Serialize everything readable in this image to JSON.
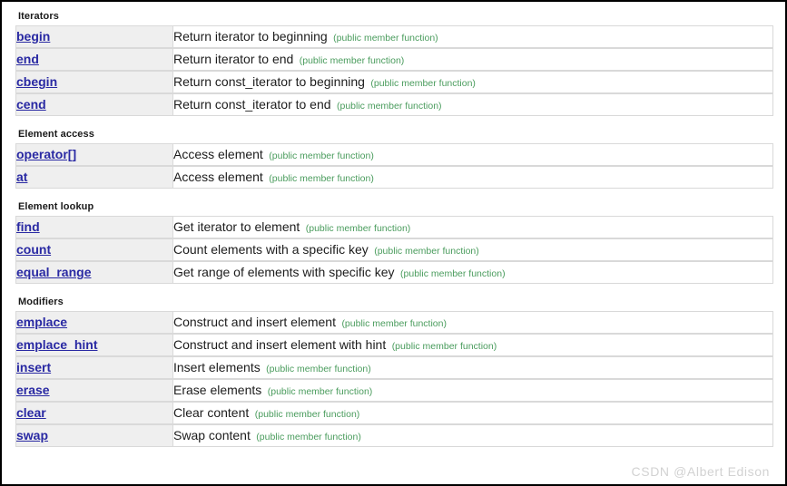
{
  "watermark": "CSDN @Albert Edison",
  "note_label": "(public member function)",
  "sections": [
    {
      "title": "Iterators",
      "rows": [
        {
          "name": "begin",
          "desc": "Return iterator to beginning",
          "note": "(public member function)"
        },
        {
          "name": "end",
          "desc": "Return iterator to end",
          "note": "(public member function)"
        },
        {
          "name": "cbegin",
          "desc": "Return const_iterator to beginning",
          "note": "(public member function)"
        },
        {
          "name": "cend",
          "desc": "Return const_iterator to end",
          "note": "(public member function)"
        }
      ]
    },
    {
      "title": "Element access",
      "rows": [
        {
          "name": "operator[]",
          "desc": "Access element",
          "note": "(public member function)"
        },
        {
          "name": "at",
          "desc": "Access element",
          "note": "(public member function)"
        }
      ]
    },
    {
      "title": "Element lookup",
      "rows": [
        {
          "name": "find",
          "desc": "Get iterator to element",
          "note": "(public member function)"
        },
        {
          "name": "count",
          "desc": "Count elements with a specific key",
          "note": "(public member function)"
        },
        {
          "name": "equal_range",
          "desc": "Get range of elements with specific key",
          "note": "(public member function)"
        }
      ]
    },
    {
      "title": "Modifiers",
      "rows": [
        {
          "name": "emplace",
          "desc": "Construct and insert element",
          "note": "(public member function)"
        },
        {
          "name": "emplace_hint",
          "desc": "Construct and insert element with hint",
          "note": "(public member function)"
        },
        {
          "name": "insert",
          "desc": "Insert elements",
          "note": "(public member function)"
        },
        {
          "name": "erase",
          "desc": "Erase elements",
          "note": "(public member function)"
        },
        {
          "name": "clear",
          "desc": "Clear content",
          "note": "(public member function)"
        },
        {
          "name": "swap",
          "desc": "Swap content",
          "note": "(public member function)"
        }
      ]
    }
  ],
  "colors": {
    "link": "#2929a3",
    "note": "#4a9c5d",
    "name_cell_bg": "#efefef",
    "border": "#d9d9d9",
    "watermark": "#d2d2d2"
  }
}
